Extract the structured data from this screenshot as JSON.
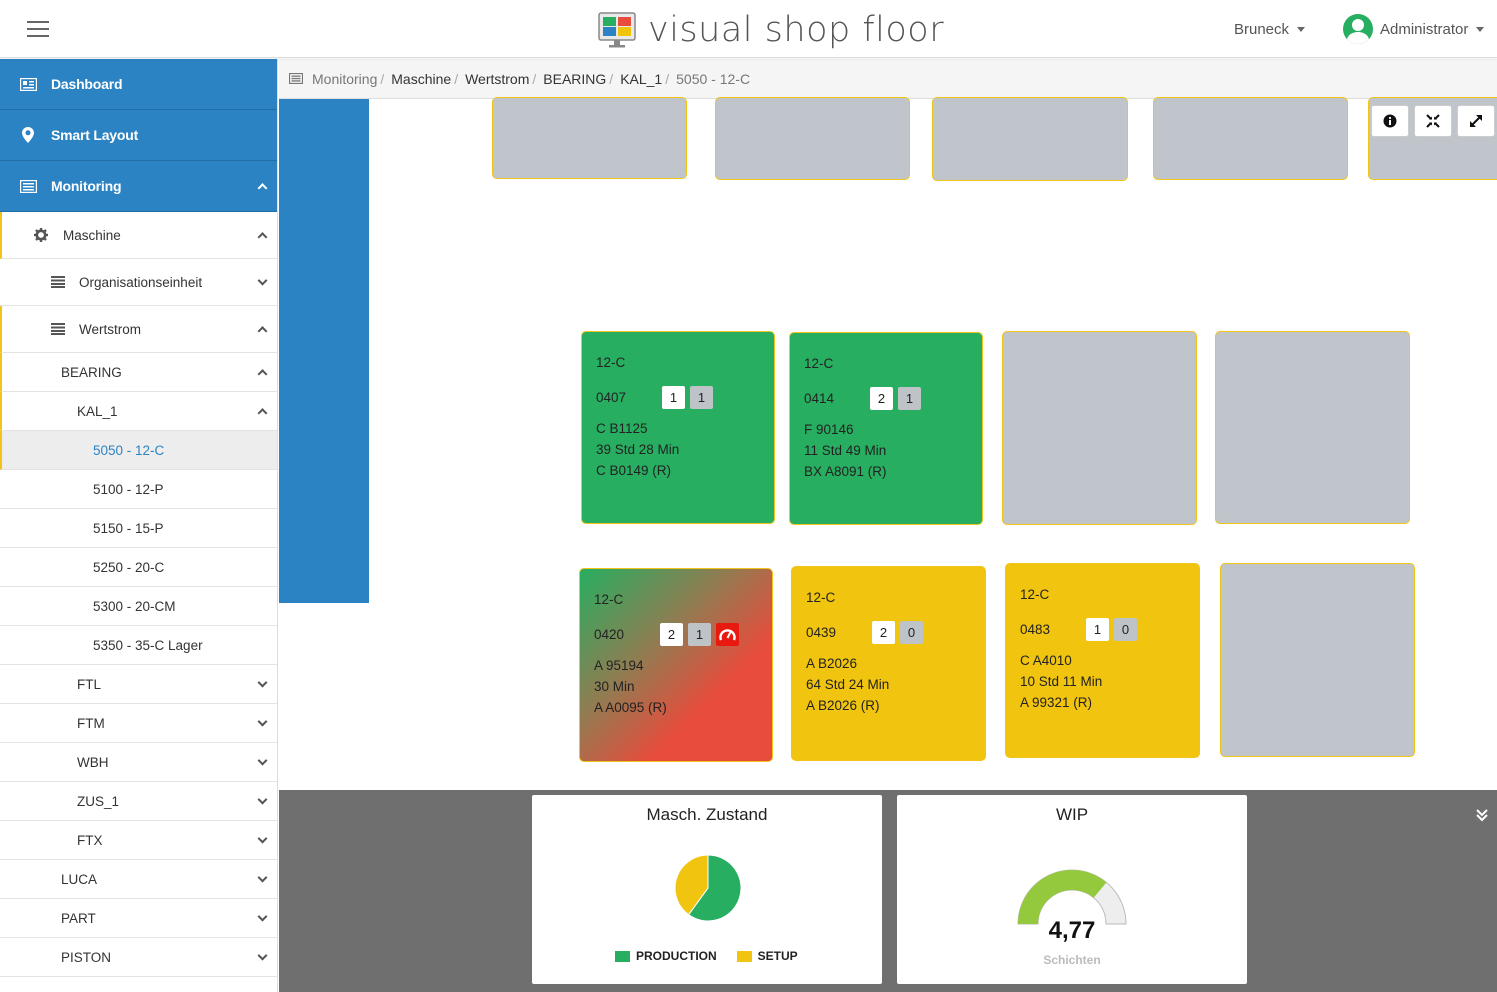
{
  "header": {
    "brand": "visual shop floor",
    "location": "Bruneck",
    "user": "Administrator",
    "colors": {
      "blue": "#2c83c3",
      "green": "#27ae60",
      "yellow": "#f1c40f",
      "red": "#e8190f",
      "grey": "#bfc5ca"
    }
  },
  "sidebar": {
    "dashboard": "Dashboard",
    "smart_layout": "Smart Layout",
    "monitoring": "Monitoring",
    "maschine": "Maschine",
    "organisationseinheit": "Organisationseinheit",
    "wertstrom": "Wertstrom",
    "bearing": "BEARING",
    "kal1": "KAL_1",
    "machines": [
      "5050 - 12-C",
      "5100 - 12-P",
      "5150 - 15-P",
      "5250 - 20-C",
      "5300 - 20-CM",
      "5350 - 35-C Lager"
    ],
    "streams": [
      "FTL",
      "FTM",
      "WBH",
      "ZUS_1",
      "FTX"
    ],
    "groups": [
      "LUCA",
      "PART",
      "PISTON"
    ]
  },
  "breadcrumb": [
    "Monitoring",
    "Maschine",
    "Wertstrom",
    "BEARING",
    "KAL_1",
    "5050 - 12-C"
  ],
  "tiles": [
    {
      "label": "12-C",
      "id": "0407",
      "b1": "1",
      "b2": "1",
      "order": "C B1125",
      "time": "39 Std 28 Min",
      "next": "C B0149 (R)",
      "state": "production"
    },
    {
      "label": "12-C",
      "id": "0414",
      "b1": "2",
      "b2": "1",
      "order": "F 90146",
      "time": "11 Std 49 Min",
      "next": "BX A8091 (R)",
      "state": "production"
    },
    {
      "label": "12-C",
      "id": "0420",
      "b1": "2",
      "b2": "1",
      "order": "A 95194",
      "time": "30 Min",
      "next": "A A0095 (R)",
      "state": "alarm"
    },
    {
      "label": "12-C",
      "id": "0439",
      "b1": "2",
      "b2": "0",
      "order": "A B2026",
      "time": "64 Std 24 Min",
      "next": "A B2026 (R)",
      "state": "setup"
    },
    {
      "label": "12-C",
      "id": "0483",
      "b1": "1",
      "b2": "0",
      "order": "C A4010",
      "time": "10 Std 11 Min",
      "next": "A 99321 (R)",
      "state": "setup"
    }
  ],
  "widgets": {
    "zustand_title": "Masch. Zustand",
    "legend_production": "PRODUCTION",
    "legend_setup": "SETUP",
    "wip_title": "WIP",
    "wip_value": "4,77",
    "wip_unit": "Schichten"
  },
  "chart_data": [
    {
      "type": "pie",
      "categories": [
        "PRODUCTION",
        "SETUP"
      ],
      "values": [
        60,
        40
      ],
      "colors": [
        "#27ae60",
        "#f1c40f"
      ],
      "title": "Masch. Zustand",
      "legend": "bottom"
    },
    {
      "type": "gauge",
      "value": 4.77,
      "fraction": 0.72,
      "title": "WIP",
      "unit": "Schichten"
    }
  ]
}
